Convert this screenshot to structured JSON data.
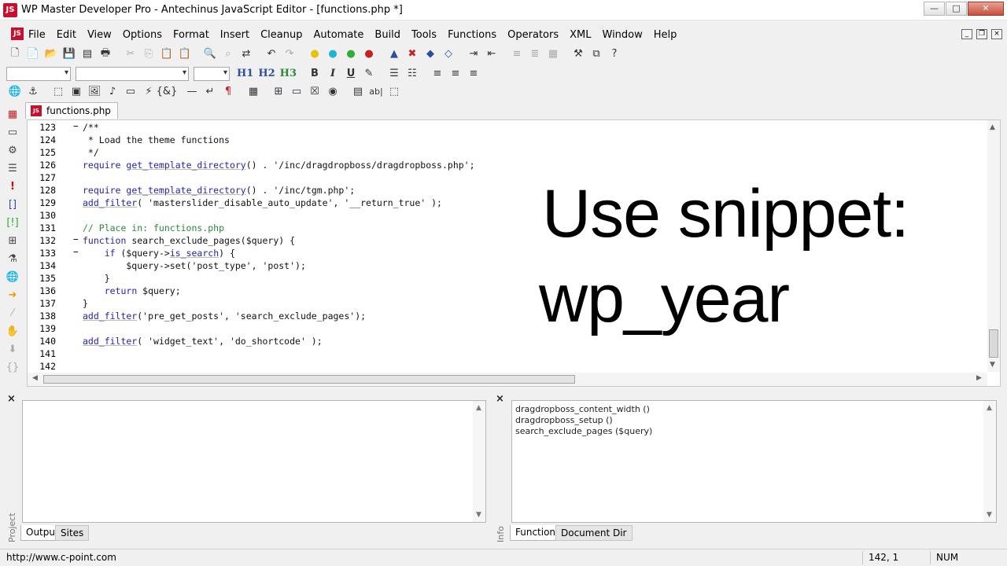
{
  "window": {
    "title": "WP Master Developer Pro - Antechinus JavaScript Editor - [functions.php *]",
    "buttons": {
      "minimize": "—",
      "maximize": "□",
      "close": "✕"
    }
  },
  "menu": [
    "File",
    "Edit",
    "View",
    "Options",
    "Format",
    "Insert",
    "Cleanup",
    "Automate",
    "Build",
    "Tools",
    "Functions",
    "Operators",
    "XML",
    "Window",
    "Help"
  ],
  "mdi_buttons": [
    "_",
    "❐",
    "×"
  ],
  "format_toolbar": {
    "h1": "H1",
    "h2": "H2",
    "h3": "H3",
    "bold": "B",
    "italic": "I",
    "underline": "U"
  },
  "tab": {
    "label": "functions.php *"
  },
  "editor": {
    "lines": [
      {
        "num": "123",
        "fold": "−",
        "segments": [
          {
            "t": "/**",
            "c": "c-plain"
          }
        ]
      },
      {
        "num": "124",
        "fold": "",
        "segments": [
          {
            "t": " * Load the theme functions",
            "c": "c-plain"
          }
        ]
      },
      {
        "num": "125",
        "fold": "",
        "segments": [
          {
            "t": " */",
            "c": "c-plain"
          }
        ]
      },
      {
        "num": "126",
        "fold": "",
        "segments": [
          {
            "t": "require",
            "c": "c-kw"
          },
          {
            "t": " ",
            "c": "c-plain"
          },
          {
            "t": "get_template_directory",
            "c": "c-fn"
          },
          {
            "t": "() . '/inc/dragdropboss/dragdropboss.php';",
            "c": "c-plain"
          }
        ]
      },
      {
        "num": "127",
        "fold": "",
        "segments": []
      },
      {
        "num": "128",
        "fold": "",
        "segments": [
          {
            "t": "require",
            "c": "c-kw"
          },
          {
            "t": " ",
            "c": "c-plain"
          },
          {
            "t": "get_template_directory",
            "c": "c-fn"
          },
          {
            "t": "() . '/inc/tgm.php';",
            "c": "c-plain"
          }
        ]
      },
      {
        "num": "129",
        "fold": "",
        "segments": [
          {
            "t": "add_filter",
            "c": "c-fn"
          },
          {
            "t": "( 'masterslider_disable_auto_update', '__return_true' );",
            "c": "c-plain"
          }
        ]
      },
      {
        "num": "130",
        "fold": "",
        "segments": []
      },
      {
        "num": "131",
        "fold": "",
        "segments": [
          {
            "t": "// Place in: functions.php",
            "c": "c-cm"
          }
        ]
      },
      {
        "num": "132",
        "fold": "−",
        "segments": [
          {
            "t": "function",
            "c": "c-kw"
          },
          {
            "t": " search_exclude_pages($query) {",
            "c": "c-plain"
          }
        ]
      },
      {
        "num": "133",
        "fold": "−",
        "segments": [
          {
            "t": "    ",
            "c": "c-plain"
          },
          {
            "t": "if",
            "c": "c-kw"
          },
          {
            "t": " ($query->",
            "c": "c-plain"
          },
          {
            "t": "is_search",
            "c": "c-fn"
          },
          {
            "t": ") {",
            "c": "c-plain"
          }
        ]
      },
      {
        "num": "134",
        "fold": "",
        "segments": [
          {
            "t": "        $query->set('post_type', 'post');",
            "c": "c-plain"
          }
        ]
      },
      {
        "num": "135",
        "fold": "",
        "segments": [
          {
            "t": "    }",
            "c": "c-plain"
          }
        ]
      },
      {
        "num": "136",
        "fold": "",
        "segments": [
          {
            "t": "    ",
            "c": "c-plain"
          },
          {
            "t": "return",
            "c": "c-kw"
          },
          {
            "t": " $query;",
            "c": "c-plain"
          }
        ]
      },
      {
        "num": "137",
        "fold": "",
        "segments": [
          {
            "t": "}",
            "c": "c-plain"
          }
        ]
      },
      {
        "num": "138",
        "fold": "",
        "segments": [
          {
            "t": "add_filter",
            "c": "c-fn"
          },
          {
            "t": "('pre_get_posts', 'search_exclude_pages');",
            "c": "c-plain"
          }
        ]
      },
      {
        "num": "139",
        "fold": "",
        "segments": []
      },
      {
        "num": "140",
        "fold": "",
        "segments": [
          {
            "t": "add_filter",
            "c": "c-fn"
          },
          {
            "t": "( 'widget_text', 'do_shortcode' );",
            "c": "c-plain"
          }
        ]
      },
      {
        "num": "141",
        "fold": "",
        "segments": []
      },
      {
        "num": "142",
        "fold": "",
        "segments": []
      }
    ],
    "overlay_line1": "Use snippet:",
    "overlay_line2": "wp_year"
  },
  "output_panel": {
    "side_label": "Project",
    "tabs": [
      "Output",
      "Sites"
    ]
  },
  "info_panel": {
    "side_label": "Info",
    "functions": [
      "dragdropboss_content_width ()",
      "dragdropboss_setup ()",
      "search_exclude_pages ($query)"
    ],
    "tabs": [
      "Functions",
      "Document Dir"
    ]
  },
  "status": {
    "url": "http://www.c-point.com",
    "position": "142, 1",
    "num_lock": "NUM"
  },
  "colors": {
    "keyword": "#2424b8",
    "comment": "#2a8a3a",
    "brand": "#c8102e"
  }
}
